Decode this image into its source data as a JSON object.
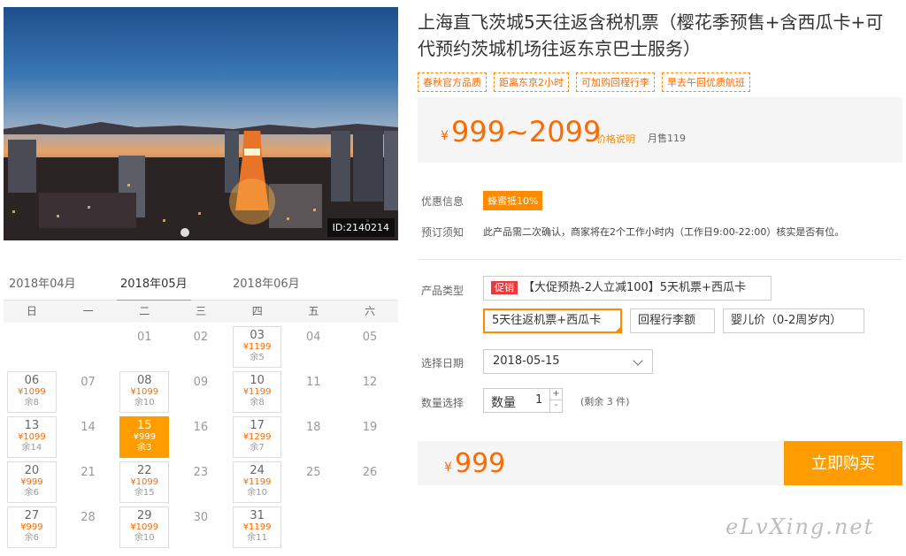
{
  "hero": {
    "image_id": "ID:2140214"
  },
  "calendar": {
    "tabs": [
      "2018年04月",
      "2018年05月",
      "2018年06月"
    ],
    "weekdays": [
      "日",
      "一",
      "二",
      "三",
      "四",
      "五",
      "六"
    ],
    "weeks": [
      [
        null,
        null,
        {
          "day": "01"
        },
        {
          "day": "02"
        },
        {
          "day": "03",
          "price": "¥1199",
          "left": "余5"
        },
        {
          "day": "04"
        },
        {
          "day": "05"
        }
      ],
      [
        {
          "day": "06",
          "price": "¥1099",
          "left": "余8"
        },
        {
          "day": "07"
        },
        {
          "day": "08",
          "price": "¥1099",
          "left": "余10"
        },
        {
          "day": "09"
        },
        {
          "day": "10",
          "price": "¥1199",
          "left": "余8"
        },
        {
          "day": "11"
        },
        {
          "day": "12"
        }
      ],
      [
        {
          "day": "13",
          "price": "¥1099",
          "left": "余14"
        },
        {
          "day": "14"
        },
        {
          "day": "15",
          "price": "¥999",
          "left": "余3",
          "selected": true
        },
        {
          "day": "16"
        },
        {
          "day": "17",
          "price": "¥1299",
          "left": "余7"
        },
        {
          "day": "18"
        },
        {
          "day": "19"
        }
      ],
      [
        {
          "day": "20",
          "price": "¥999",
          "left": "余6"
        },
        {
          "day": "21"
        },
        {
          "day": "22",
          "price": "¥1099",
          "left": "余15"
        },
        {
          "day": "23"
        },
        {
          "day": "24",
          "price": "¥1199",
          "left": "余10"
        },
        {
          "day": "25"
        },
        {
          "day": "26"
        }
      ],
      [
        {
          "day": "27",
          "price": "¥999",
          "left": "余6"
        },
        {
          "day": "28"
        },
        {
          "day": "29",
          "price": "¥1099",
          "left": "余10"
        },
        {
          "day": "30"
        },
        {
          "day": "31",
          "price": "¥1199",
          "left": "余11"
        },
        null,
        null
      ]
    ]
  },
  "product": {
    "title": "上海直飞茨城5天往返含税机票（樱花季预售+含西瓜卡+可代预约茨城机场往返东京巴士服务）",
    "tags": [
      "春秋官方品质",
      "距离东京2小时",
      "可加购回程行李",
      "早去午回优质航班"
    ],
    "price_yen": "¥",
    "price_range": "999~2099",
    "price_explain": "价格说明",
    "monthly_sales": "月售119"
  },
  "info": {
    "promo_label": "优惠信息",
    "promo_badge": "蜂蜜抵10%",
    "notice_label": "预订须知",
    "notice_text": "此产品需二次确认，商家将在2个工作小时内（工作日9:00-22:00）核实是否有位。"
  },
  "options": {
    "type_label": "产品类型",
    "hot_badge": "促销",
    "items": [
      "【大促预热-2人立减100】5天机票+西瓜卡",
      "5天往返机票+西瓜卡",
      "回程行李额",
      "婴儿价（0-2周岁内）"
    ],
    "selected_index": 1
  },
  "date": {
    "label": "选择日期",
    "value": "2018-05-15"
  },
  "quantity": {
    "label": "数量选择",
    "field_label": "数量",
    "value": "1",
    "plus": "+",
    "minus": "-",
    "remaining": "(剩余 3 件)"
  },
  "buy": {
    "yen": "¥",
    "amount": "999",
    "button": "立即购买"
  },
  "watermark": "eLvXing.net",
  "colors": {
    "accent": "#ff8a00",
    "price": "#ff6a00",
    "button": "#ff9c00",
    "hot": "#e53b3b"
  }
}
